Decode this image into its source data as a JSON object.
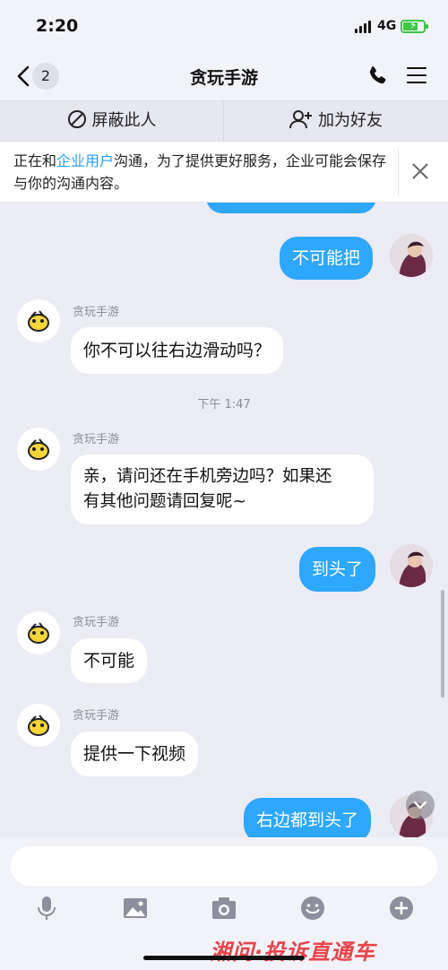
{
  "status_bar": {
    "time": "2:20",
    "network": "4G"
  },
  "nav": {
    "unread_count": "2",
    "title": "贪玩手游"
  },
  "actions": {
    "block_label": "屏蔽此人",
    "add_friend_label": "加为好友"
  },
  "notice": {
    "text_before": "正在和",
    "link_text": "企业用户",
    "text_after": "沟通，为了提供更好服务，企业可能会保存与你的沟通内容。"
  },
  "chat": {
    "messages": [
      {
        "from": "me",
        "text": "不可能把"
      },
      {
        "from": "bot",
        "sender": "贪玩手游",
        "text": "你不可以往右边滑动吗？"
      },
      {
        "time_divider": "下午 1:47"
      },
      {
        "from": "bot",
        "sender": "贪玩手游",
        "text_line1": "亲，请问还在手机旁边吗？如果还",
        "text_line2": "有其他问题请回复呢~"
      },
      {
        "from": "me",
        "text": "到头了"
      },
      {
        "from": "bot",
        "sender": "贪玩手游",
        "text": "不可能"
      },
      {
        "from": "bot",
        "sender": "贪玩手游",
        "text": "提供一下视频"
      },
      {
        "from": "me",
        "text": "右边都到头了"
      }
    ]
  },
  "input": {
    "placeholder": ""
  },
  "watermark": "湘问·投诉直通车",
  "colors": {
    "outgoing_bubble": "#2ea7ff",
    "incoming_bubble": "#ffffff",
    "background": "#ececf5",
    "link": "#2a9ef0"
  }
}
